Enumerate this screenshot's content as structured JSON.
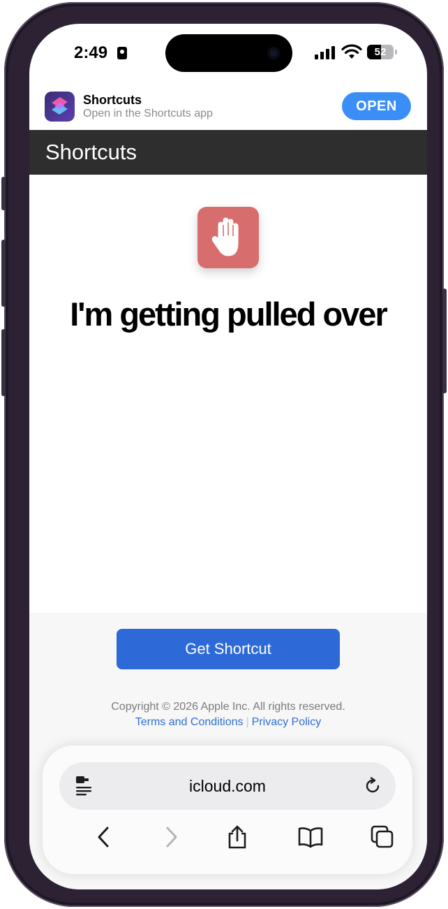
{
  "status_bar": {
    "time": "2:49",
    "battery_level": "52",
    "battery_fraction": 0.52
  },
  "app_banner": {
    "app_name": "Shortcuts",
    "subtitle": "Open in the Shortcuts app",
    "open_label": "OPEN",
    "icon": "shortcuts-app-icon"
  },
  "header": {
    "title": "Shortcuts"
  },
  "shortcut": {
    "title": "I'm getting pulled over",
    "icon": "raised-hand-icon",
    "icon_color": "#d86d6d"
  },
  "actions": {
    "get_label": "Get Shortcut",
    "button_color": "#2d6ad8"
  },
  "footer": {
    "copyright": "Copyright © 2026 Apple Inc.  All rights reserved.",
    "terms_label": "Terms and Conditions",
    "privacy_label": "Privacy Policy",
    "separator": "|"
  },
  "browser": {
    "url": "icloud.com",
    "icons": [
      "reader-icon",
      "reload-icon",
      "back-icon",
      "forward-icon",
      "share-icon",
      "bookmarks-icon",
      "tabs-icon"
    ]
  }
}
